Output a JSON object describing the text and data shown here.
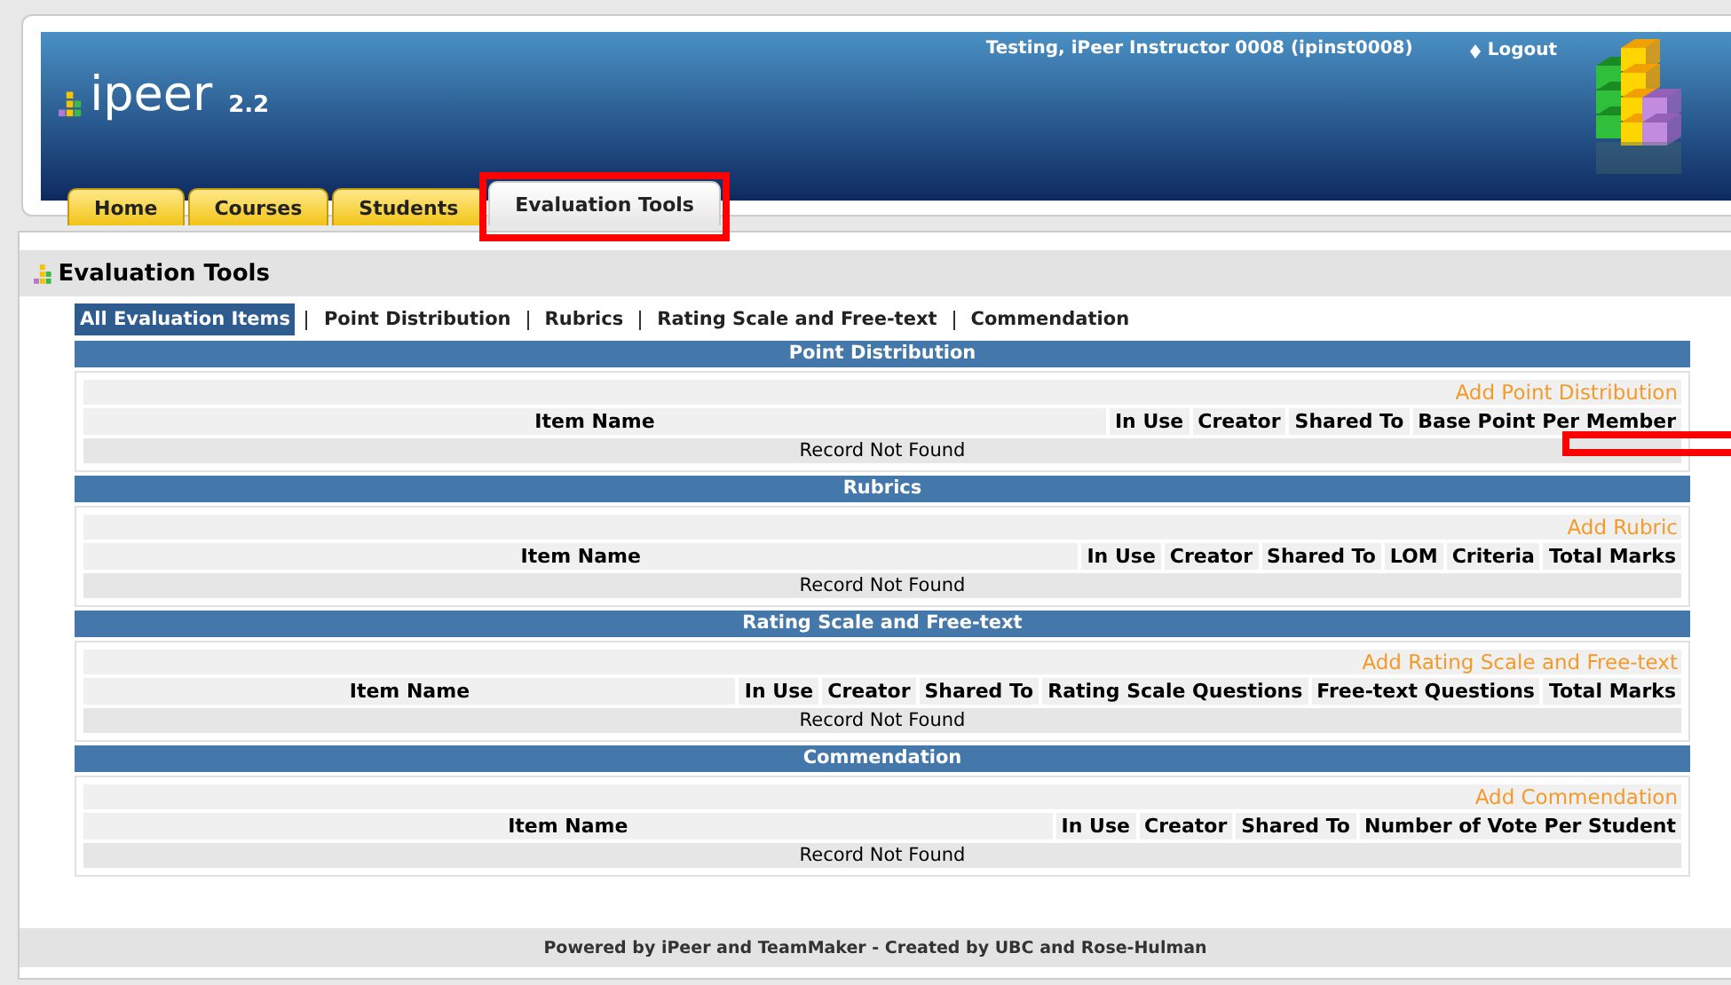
{
  "header": {
    "logo_text": "ipeer",
    "version": "2.2",
    "user": "Testing, iPeer Instructor 0008 (ipinst0008)",
    "logout": "Logout"
  },
  "tabs": [
    {
      "label": "Home",
      "selected": false,
      "highlighted": false
    },
    {
      "label": "Courses",
      "selected": false,
      "highlighted": false
    },
    {
      "label": "Students",
      "selected": false,
      "highlighted": false
    },
    {
      "label": "Evaluation Tools",
      "selected": true,
      "highlighted": true
    }
  ],
  "panel": {
    "title": "Evaluation Tools"
  },
  "filters": [
    {
      "label": "All Evaluation Items",
      "selected": true
    },
    {
      "label": "Point Distribution",
      "selected": false
    },
    {
      "label": "Rubrics",
      "selected": false
    },
    {
      "label": "Rating Scale and Free-text",
      "selected": false
    },
    {
      "label": "Commendation",
      "selected": false
    }
  ],
  "sections": [
    {
      "title": "Point Distribution",
      "add_link": "Add Point Distribution",
      "columns": [
        {
          "label": "Item Name",
          "highlighted": false
        },
        {
          "label": "In Use",
          "highlighted": false
        },
        {
          "label": "Creator",
          "highlighted": false
        },
        {
          "label": "Shared To",
          "highlighted": false
        },
        {
          "label": "Base Point Per Member",
          "highlighted": true
        }
      ],
      "empty_text": "Record Not Found"
    },
    {
      "title": "Rubrics",
      "add_link": "Add Rubric",
      "columns": [
        {
          "label": "Item Name",
          "highlighted": false
        },
        {
          "label": "In Use",
          "highlighted": false
        },
        {
          "label": "Creator",
          "highlighted": false
        },
        {
          "label": "Shared To",
          "highlighted": false
        },
        {
          "label": "LOM",
          "highlighted": false
        },
        {
          "label": "Criteria",
          "highlighted": false
        },
        {
          "label": "Total Marks",
          "highlighted": false
        }
      ],
      "empty_text": "Record Not Found"
    },
    {
      "title": "Rating Scale and Free-text",
      "add_link": "Add Rating Scale and Free-text",
      "columns": [
        {
          "label": "Item Name",
          "highlighted": false
        },
        {
          "label": "In Use",
          "highlighted": false
        },
        {
          "label": "Creator",
          "highlighted": false
        },
        {
          "label": "Shared To",
          "highlighted": false
        },
        {
          "label": "Rating Scale Questions",
          "highlighted": false
        },
        {
          "label": "Free-text Questions",
          "highlighted": false
        },
        {
          "label": "Total Marks",
          "highlighted": false
        }
      ],
      "empty_text": "Record Not Found"
    },
    {
      "title": "Commendation",
      "add_link": "Add Commendation",
      "columns": [
        {
          "label": "Item Name",
          "highlighted": false
        },
        {
          "label": "In Use",
          "highlighted": false
        },
        {
          "label": "Creator",
          "highlighted": false
        },
        {
          "label": "Shared To",
          "highlighted": false
        },
        {
          "label": "Number of Vote Per Student",
          "highlighted": false
        }
      ],
      "empty_text": "Record Not Found"
    }
  ],
  "footer": "Powered by iPeer and TeamMaker - Created by UBC and Rose-Hulman"
}
